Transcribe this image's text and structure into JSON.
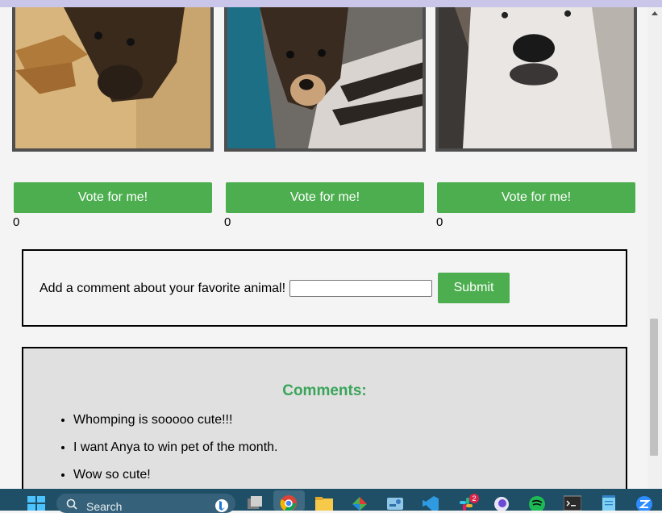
{
  "pets": [
    {
      "vote_label": "Vote for me!",
      "votes": "0"
    },
    {
      "vote_label": "Vote for me!",
      "votes": "0"
    },
    {
      "vote_label": "Vote for me!",
      "votes": "0"
    }
  ],
  "comment_form": {
    "label": "Add a comment about your favorite animal!",
    "input_value": "",
    "submit_label": "Submit"
  },
  "comments": {
    "title": "Comments:",
    "items": [
      "Whomping is sooooo cute!!!",
      "I want Anya to win pet of the month.",
      "Wow so cute!"
    ]
  },
  "taskbar": {
    "search_placeholder": "Search",
    "slack_badge": "2"
  },
  "colors": {
    "accent_green": "#4cae4f",
    "title_green": "#3aa55a",
    "taskbar": "#1f4f66"
  }
}
